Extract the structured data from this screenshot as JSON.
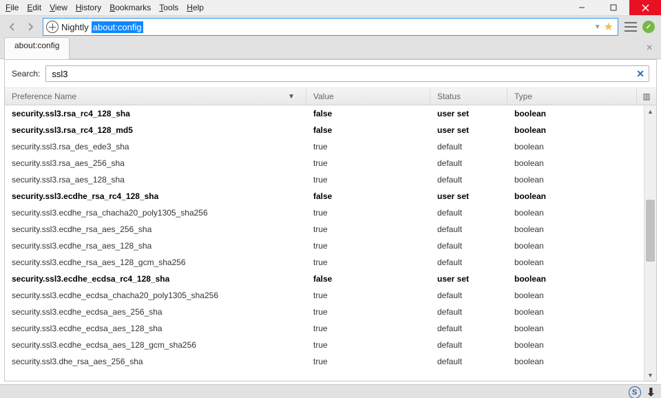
{
  "menubar": [
    "File",
    "Edit",
    "View",
    "History",
    "Bookmarks",
    "Tools",
    "Help"
  ],
  "nav": {
    "brand": "Nightly",
    "url": "about:config"
  },
  "tab": {
    "title": "about:config"
  },
  "search": {
    "label": "Search:",
    "value": "ssl3"
  },
  "columns": {
    "name": "Preference Name",
    "value": "Value",
    "status": "Status",
    "type": "Type"
  },
  "rows": [
    {
      "name": "security.ssl3.rsa_rc4_128_sha",
      "value": "false",
      "status": "user set",
      "type": "boolean",
      "bold": true
    },
    {
      "name": "security.ssl3.rsa_rc4_128_md5",
      "value": "false",
      "status": "user set",
      "type": "boolean",
      "bold": true
    },
    {
      "name": "security.ssl3.rsa_des_ede3_sha",
      "value": "true",
      "status": "default",
      "type": "boolean",
      "bold": false
    },
    {
      "name": "security.ssl3.rsa_aes_256_sha",
      "value": "true",
      "status": "default",
      "type": "boolean",
      "bold": false
    },
    {
      "name": "security.ssl3.rsa_aes_128_sha",
      "value": "true",
      "status": "default",
      "type": "boolean",
      "bold": false
    },
    {
      "name": "security.ssl3.ecdhe_rsa_rc4_128_sha",
      "value": "false",
      "status": "user set",
      "type": "boolean",
      "bold": true
    },
    {
      "name": "security.ssl3.ecdhe_rsa_chacha20_poly1305_sha256",
      "value": "true",
      "status": "default",
      "type": "boolean",
      "bold": false
    },
    {
      "name": "security.ssl3.ecdhe_rsa_aes_256_sha",
      "value": "true",
      "status": "default",
      "type": "boolean",
      "bold": false
    },
    {
      "name": "security.ssl3.ecdhe_rsa_aes_128_sha",
      "value": "true",
      "status": "default",
      "type": "boolean",
      "bold": false
    },
    {
      "name": "security.ssl3.ecdhe_rsa_aes_128_gcm_sha256",
      "value": "true",
      "status": "default",
      "type": "boolean",
      "bold": false
    },
    {
      "name": "security.ssl3.ecdhe_ecdsa_rc4_128_sha",
      "value": "false",
      "status": "user set",
      "type": "boolean",
      "bold": true
    },
    {
      "name": "security.ssl3.ecdhe_ecdsa_chacha20_poly1305_sha256",
      "value": "true",
      "status": "default",
      "type": "boolean",
      "bold": false
    },
    {
      "name": "security.ssl3.ecdhe_ecdsa_aes_256_sha",
      "value": "true",
      "status": "default",
      "type": "boolean",
      "bold": false
    },
    {
      "name": "security.ssl3.ecdhe_ecdsa_aes_128_sha",
      "value": "true",
      "status": "default",
      "type": "boolean",
      "bold": false
    },
    {
      "name": "security.ssl3.ecdhe_ecdsa_aes_128_gcm_sha256",
      "value": "true",
      "status": "default",
      "type": "boolean",
      "bold": false
    },
    {
      "name": "security.ssl3.dhe_rsa_aes_256_sha",
      "value": "true",
      "status": "default",
      "type": "boolean",
      "bold": false
    }
  ]
}
